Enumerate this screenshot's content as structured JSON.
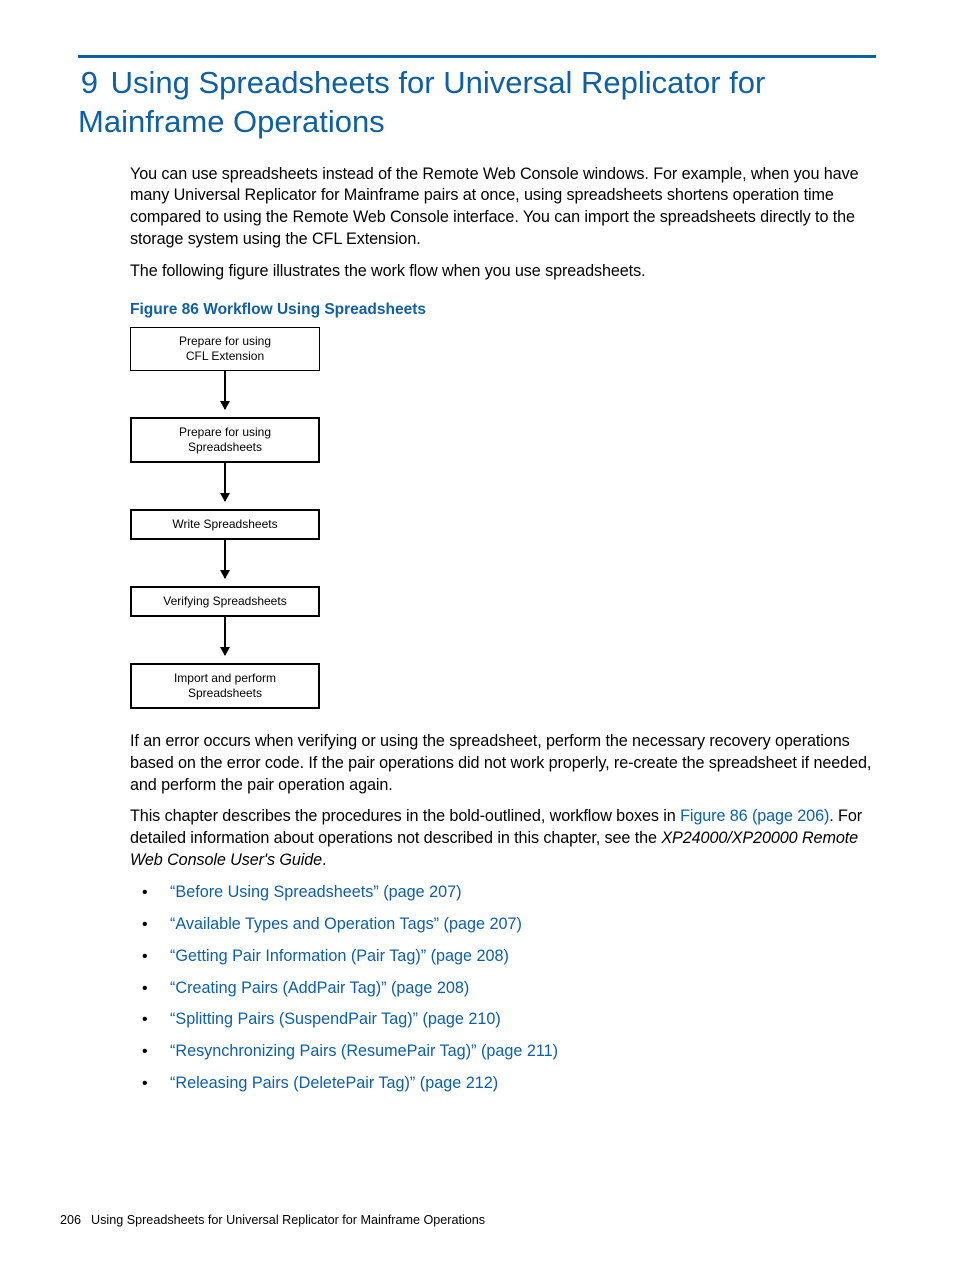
{
  "chapter": {
    "number": "9",
    "title": "Using Spreadsheets for Universal Replicator for Mainframe Operations"
  },
  "paras": {
    "intro1": "You can use spreadsheets instead of the Remote Web Console windows. For example, when you have many Universal Replicator for Mainframe pairs at once, using spreadsheets shortens operation time compared to using the Remote Web Console interface. You can import the spreadsheets directly to the storage system using the CFL Extension.",
    "intro2": "The following figure illustrates the work flow when you use spreadsheets.",
    "figcap": "Figure 86 Workflow Using Spreadsheets",
    "after1": "If an error occurs when verifying or using the spreadsheet, perform the necessary recovery operations based on the error code. If the pair operations did not work properly, re-create the spreadsheet if needed, and perform the pair operation again.",
    "after2_pre": "This chapter describes the procedures in the bold-outlined, workflow boxes in ",
    "after2_link": "Figure 86 (page 206)",
    "after2_mid": ". For detailed information about operations not described in this chapter, see the ",
    "after2_ital": "XP24000/XP20000 Remote Web Console User's Guide",
    "after2_end": "."
  },
  "flow": {
    "b1a": "Prepare for using",
    "b1b": "CFL Extension",
    "b2a": "Prepare for using",
    "b2b": "Spreadsheets",
    "b3": "Write Spreadsheets",
    "b4": "Verifying Spreadsheets",
    "b5a": "Import and perform",
    "b5b": "Spreadsheets"
  },
  "toc": [
    "“Before Using Spreadsheets” (page 207)",
    "“Available Types and Operation Tags” (page 207)",
    "“Getting Pair Information (Pair Tag)” (page 208)",
    "“Creating Pairs (AddPair Tag)” (page 208)",
    "“Splitting Pairs (SuspendPair Tag)” (page 210)",
    "“Resynchronizing Pairs (ResumePair Tag)” (page 211)",
    "“Releasing Pairs (DeletePair Tag)” (page 212)"
  ],
  "footer": {
    "page": "206",
    "text": "Using Spreadsheets for Universal Replicator for Mainframe Operations"
  }
}
